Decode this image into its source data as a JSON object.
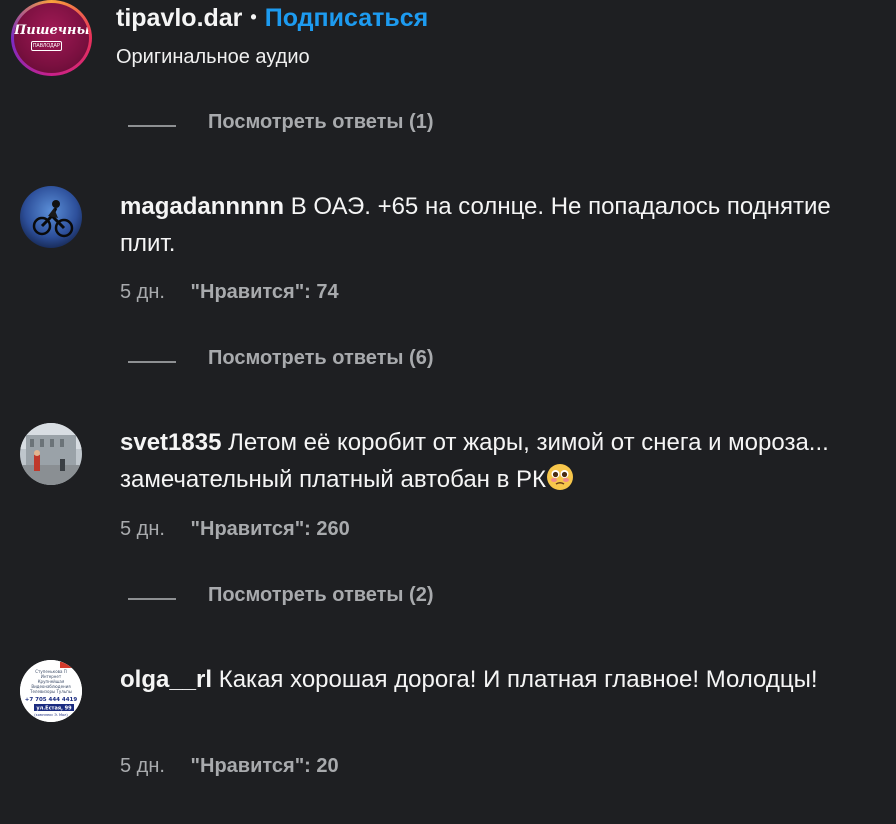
{
  "header": {
    "username": "tipavlo.dar",
    "separator": "•",
    "follow_label": "Подписаться",
    "audio_label": "Оригинальное аудио",
    "logo_text": "Пишечный",
    "logo_plaque": "ПАВЛОДАР"
  },
  "replies": [
    {
      "label": "Посмотреть ответы (1)"
    },
    {
      "label": "Посмотреть ответы (6)"
    },
    {
      "label": "Посмотреть ответы (2)"
    }
  ],
  "comments": [
    {
      "username": "magadannnnn",
      "text": "В ОАЭ. +65 на солнце. Не попадалось поднятие плит.",
      "time": "5 дн.",
      "likes": "\"Нравится\": 74",
      "avatar_icon": "cyclist-avatar"
    },
    {
      "username": "svet1835",
      "text": "Летом её коробит от жары, зимой от снега и мороза... замечательный платный автобан в РК",
      "emoji": "flushed-face-emoji",
      "time": "5 дн.",
      "likes": "\"Нравится\": 260",
      "avatar_icon": "street-photo-avatar"
    },
    {
      "username": "olga__rl",
      "text": "Какая хорошая дорога! И платная главное! Молодцы!",
      "time": "5 дн.",
      "likes": "\"Нравится\": 20",
      "avatar_icon": "business-card-avatar",
      "avatar_lines": [
        "Ступенькова П",
        "Интернет",
        "Крупнейшая",
        "Видеонаблюдения",
        "Телевизоры Тульпы",
        "+7 705 444 4419",
        "ул.Естая, 99",
        "(комплекс Э. Мол)"
      ]
    }
  ],
  "colors": {
    "background": "#1e1f22",
    "text": "#f5f5f5",
    "muted": "#a8aaad",
    "link": "#1d9bf0"
  }
}
